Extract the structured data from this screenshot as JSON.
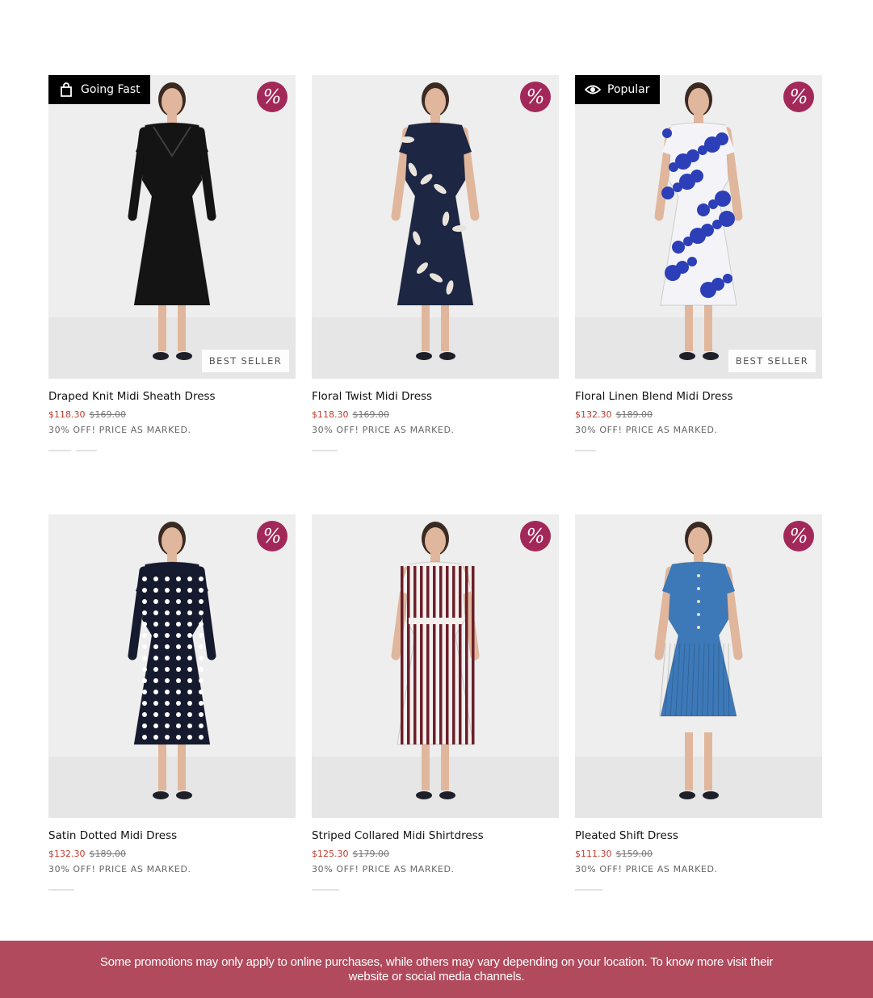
{
  "products": [
    {
      "name": "Draped Knit Midi Sheath Dress",
      "sale_price": "$118.30",
      "original_price": "$169.00",
      "promo": "30% OFF! PRICE AS MARKED.",
      "flag": "Going Fast",
      "flag_icon": "shopping-bag-icon",
      "badge": "BEST SELLER",
      "discount_symbol": "%",
      "dress_color": "#141414",
      "pattern": "solid"
    },
    {
      "name": "Floral Twist Midi Dress",
      "sale_price": "$118.30",
      "original_price": "$169.00",
      "promo": "30% OFF! PRICE AS MARKED.",
      "flag": "",
      "badge": "",
      "discount_symbol": "%",
      "dress_color": "#1d2744",
      "pattern": "floral-light"
    },
    {
      "name": "Floral Linen Blend Midi Dress",
      "sale_price": "$132.30",
      "original_price": "$189.00",
      "promo": "30% OFF! PRICE AS MARKED.",
      "flag": "Popular",
      "flag_icon": "eye-icon",
      "badge": "BEST SELLER",
      "discount_symbol": "%",
      "dress_color": "#f4f4f8",
      "pattern": "floral-blue"
    },
    {
      "name": "Satin Dotted Midi Dress",
      "sale_price": "$132.30",
      "original_price": "$189.00",
      "promo": "30% OFF! PRICE AS MARKED.",
      "flag": "",
      "badge": "",
      "discount_symbol": "%",
      "dress_color": "#161a2e",
      "pattern": "dots"
    },
    {
      "name": "Striped Collared Midi Shirtdress",
      "sale_price": "$125.30",
      "original_price": "$179.00",
      "promo": "30% OFF! PRICE AS MARKED.",
      "flag": "",
      "badge": "",
      "discount_symbol": "%",
      "dress_color": "#f4f0ee",
      "pattern": "stripes"
    },
    {
      "name": "Pleated Shift Dress",
      "sale_price": "$111.30",
      "original_price": "$159.00",
      "promo": "30% OFF! PRICE AS MARKED.",
      "flag": "",
      "badge": "",
      "discount_symbol": "%",
      "dress_color": "#3d79b8",
      "pattern": "pleats"
    }
  ],
  "footer": {
    "notice": "Some promotions may only apply to online purchases, while others may vary depending on your location. To know more visit their website or social media channels."
  },
  "colors": {
    "discount_badge": "#a3285a",
    "sale_price": "#c0392b",
    "footer_banner": "#b04a5c"
  }
}
